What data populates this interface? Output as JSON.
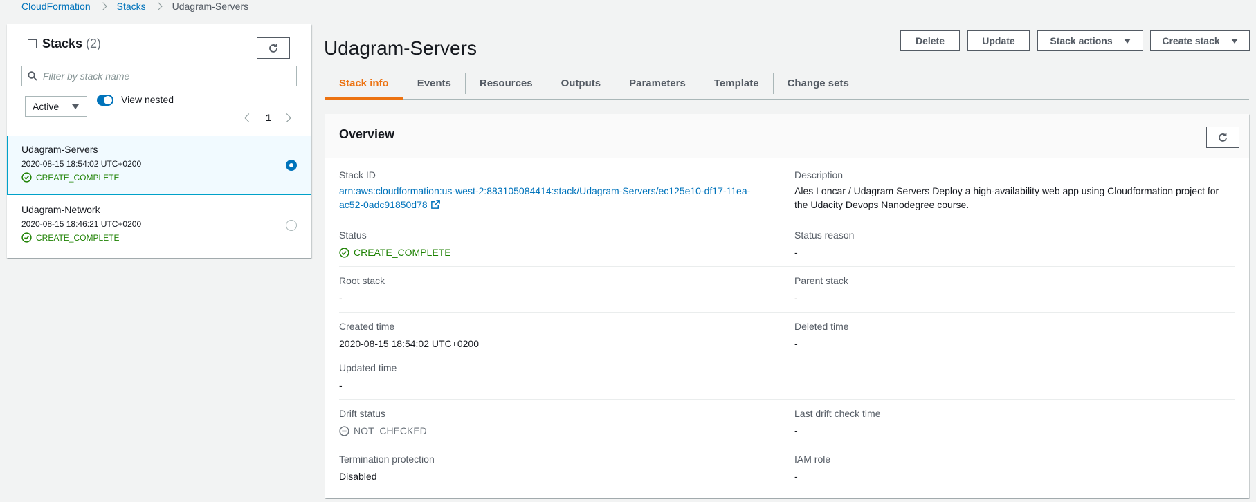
{
  "breadcrumb": {
    "items": [
      "CloudFormation",
      "Stacks"
    ],
    "current": "Udagram-Servers"
  },
  "sidebar": {
    "title": "Stacks",
    "count": "(2)",
    "search_placeholder": "Filter by stack name",
    "filter_value": "Active",
    "toggle_label": "View nested",
    "toggle_on": true,
    "page": "1",
    "stacks": [
      {
        "name": "Udagram-Servers",
        "date": "2020-08-15 18:54:02 UTC+0200",
        "status": "CREATE_COMPLETE",
        "selected": true
      },
      {
        "name": "Udagram-Network",
        "date": "2020-08-15 18:46:21 UTC+0200",
        "status": "CREATE_COMPLETE",
        "selected": false
      }
    ]
  },
  "main": {
    "title": "Udagram-Servers",
    "buttons": {
      "delete": "Delete",
      "update": "Update",
      "stack_actions": "Stack actions",
      "create_stack": "Create stack"
    },
    "tabs": [
      "Stack info",
      "Events",
      "Resources",
      "Outputs",
      "Parameters",
      "Template",
      "Change sets"
    ],
    "active_tab": "Stack info"
  },
  "overview": {
    "title": "Overview",
    "stack_id_label": "Stack ID",
    "stack_id_line1": "arn:aws:cloudformation:us-west-2:883105084414:stack/Udagram-Servers/ec125e10-df17-11ea-",
    "stack_id_line2": "ac52-0adc91850d78",
    "description_label": "Description",
    "description_line1": "Ales Loncar / Udagram Servers Deploy a high-availability web app using Cloudformation project for",
    "description_line2": "the Udacity Devops Nanodegree course.",
    "status_label": "Status",
    "status_value": "CREATE_COMPLETE",
    "status_reason_label": "Status reason",
    "status_reason_value": "-",
    "root_stack_label": "Root stack",
    "root_stack_value": "-",
    "parent_stack_label": "Parent stack",
    "parent_stack_value": "-",
    "created_time_label": "Created time",
    "created_time_value": "2020-08-15 18:54:02 UTC+0200",
    "deleted_time_label": "Deleted time",
    "deleted_time_value": "-",
    "updated_time_label": "Updated time",
    "updated_time_value": "-",
    "drift_status_label": "Drift status",
    "drift_status_value": "NOT_CHECKED",
    "last_drift_label": "Last drift check time",
    "last_drift_value": "-",
    "termination_label": "Termination protection",
    "termination_value": "Disabled",
    "iam_role_label": "IAM role",
    "iam_role_value": "-"
  },
  "colors": {
    "link": "#0073bb",
    "success": "#1d8102",
    "active_tab": "#ec7211",
    "selected_bg": "#f1faff",
    "selected_border": "#00a1c9"
  },
  "icons": [
    "refresh-icon",
    "search-icon",
    "collapse-icon",
    "check-circle-icon",
    "external-link-icon",
    "not-checked-icon",
    "chevron-down-icon"
  ]
}
